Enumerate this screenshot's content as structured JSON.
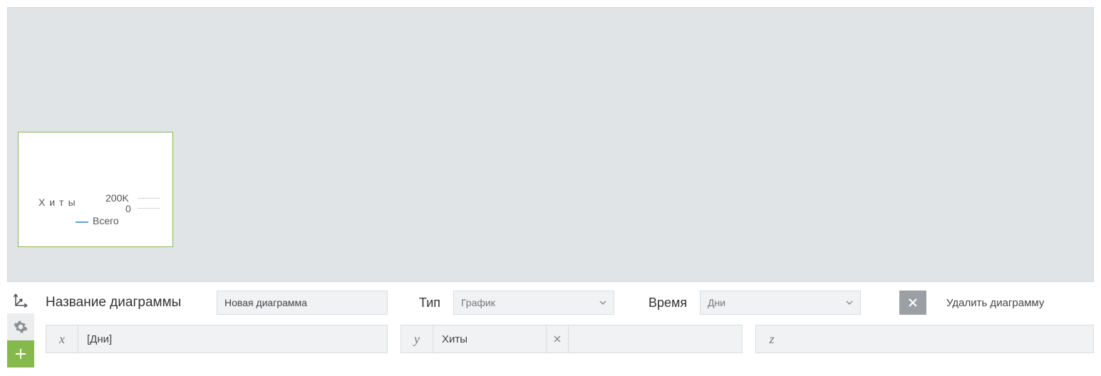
{
  "thumbnail": {
    "ylabel": "Хиты",
    "tick_top": "200K",
    "tick_bottom": "0",
    "legend": "Всего"
  },
  "form": {
    "name_label": "Название диаграммы",
    "name_value": "Новая диаграмма",
    "type_label": "Тип",
    "type_value": "График",
    "time_label": "Время",
    "time_value": "Дни",
    "delete_label": "Удалить диаграмму"
  },
  "axes": {
    "x_letter": "x",
    "x_value": "[Дни]",
    "y_letter": "y",
    "y_value": "Хиты",
    "z_letter": "z",
    "z_value": ""
  },
  "chart_data": {
    "type": "line",
    "ylabel": "Хиты",
    "ylim": [
      0,
      200000
    ],
    "ytick_labels": [
      "0",
      "200K"
    ],
    "series": [
      {
        "name": "Всего",
        "values": []
      }
    ]
  }
}
